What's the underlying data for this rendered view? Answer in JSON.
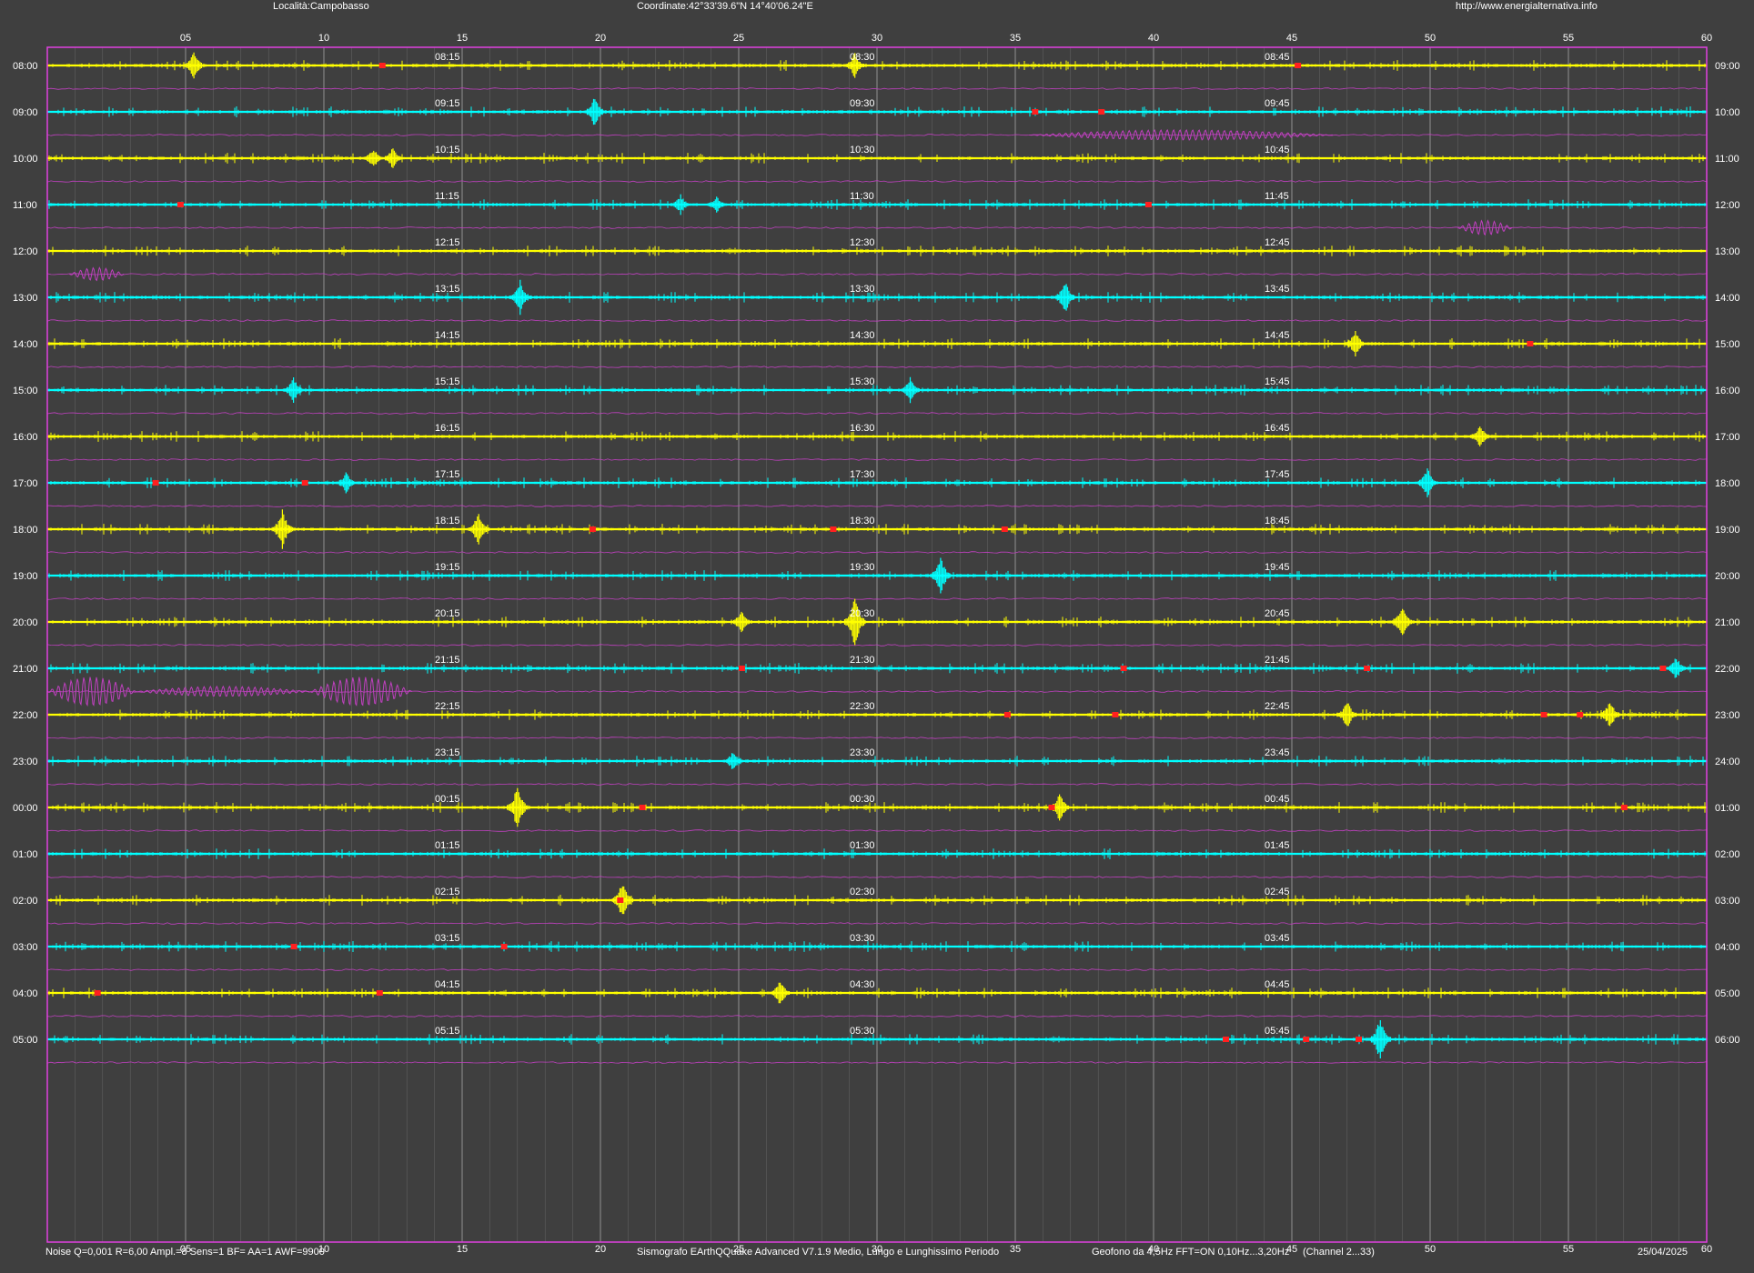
{
  "header": {
    "location": "Località:Campobasso",
    "coordinates": "Coordinate:42°33'39.6\"N  14°40'06.24\"E",
    "website": "http://www.energialternativa.info"
  },
  "footer": {
    "noise_params": "Noise Q=0,001 R=6,00 Ampl.=8 Sens=1 BF= AA=1 AWF=9900",
    "software": "Sismografo  EArthQQuake Advanced V7.1.9  Medio, Lungo e Lunghissimo Periodo",
    "sensor": "Geofono da 4,5Hz FFT=ON 0,10Hz...3,20Hz",
    "channels": "(Channel 2...33)",
    "date": "25/04/2025"
  },
  "colors": {
    "background": "#3f3f3f",
    "frame": "#e040e0",
    "trace_even": "#ffff00",
    "trace_odd": "#00ffff",
    "long_period": "#c040c0",
    "event_marker": "#ff2020",
    "grid": "#9a9a9a",
    "text": "#ffffff"
  },
  "chart_data": {
    "type": "helicorder",
    "x_axis": {
      "unit": "minutes",
      "range": [
        0,
        60
      ],
      "tick_labels": [
        "05",
        "10",
        "15",
        "20",
        "25",
        "30",
        "35",
        "40",
        "45",
        "50",
        "55",
        "60"
      ]
    },
    "grid": true,
    "rows": [
      {
        "left": "08:00",
        "right": "09:00",
        "q15": "08:15",
        "q30": "08:30",
        "q45": "08:45",
        "color": "yellow"
      },
      {
        "left": "09:00",
        "right": "10:00",
        "q15": "09:15",
        "q30": "09:30",
        "q45": "09:45",
        "color": "cyan"
      },
      {
        "left": "10:00",
        "right": "11:00",
        "q15": "10:15",
        "q30": "10:30",
        "q45": "10:45",
        "color": "yellow"
      },
      {
        "left": "11:00",
        "right": "12:00",
        "q15": "11:15",
        "q30": "11:30",
        "q45": "11:45",
        "color": "cyan"
      },
      {
        "left": "12:00",
        "right": "13:00",
        "q15": "12:15",
        "q30": "12:30",
        "q45": "12:45",
        "color": "yellow"
      },
      {
        "left": "13:00",
        "right": "14:00",
        "q15": "13:15",
        "q30": "13:30",
        "q45": "13:45",
        "color": "cyan"
      },
      {
        "left": "14:00",
        "right": "15:00",
        "q15": "14:15",
        "q30": "14:30",
        "q45": "14:45",
        "color": "yellow"
      },
      {
        "left": "15:00",
        "right": "16:00",
        "q15": "15:15",
        "q30": "15:30",
        "q45": "15:45",
        "color": "cyan"
      },
      {
        "left": "16:00",
        "right": "17:00",
        "q15": "16:15",
        "q30": "16:30",
        "q45": "16:45",
        "color": "yellow"
      },
      {
        "left": "17:00",
        "right": "18:00",
        "q15": "17:15",
        "q30": "17:30",
        "q45": "17:45",
        "color": "cyan"
      },
      {
        "left": "18:00",
        "right": "19:00",
        "q15": "18:15",
        "q30": "18:30",
        "q45": "18:45",
        "color": "yellow"
      },
      {
        "left": "19:00",
        "right": "20:00",
        "q15": "19:15",
        "q30": "19:30",
        "q45": "19:45",
        "color": "cyan"
      },
      {
        "left": "20:00",
        "right": "21:00",
        "q15": "20:15",
        "q30": "20:30",
        "q45": "20:45",
        "color": "yellow"
      },
      {
        "left": "21:00",
        "right": "22:00",
        "q15": "21:15",
        "q30": "21:30",
        "q45": "21:45",
        "color": "cyan"
      },
      {
        "left": "22:00",
        "right": "23:00",
        "q15": "22:15",
        "q30": "22:30",
        "q45": "22:45",
        "color": "yellow"
      },
      {
        "left": "23:00",
        "right": "24:00",
        "q15": "23:15",
        "q30": "23:30",
        "q45": "23:45",
        "color": "cyan"
      },
      {
        "left": "00:00",
        "right": "01:00",
        "q15": "00:15",
        "q30": "00:30",
        "q45": "00:45",
        "color": "yellow"
      },
      {
        "left": "01:00",
        "right": "02:00",
        "q15": "01:15",
        "q30": "01:30",
        "q45": "01:45",
        "color": "cyan"
      },
      {
        "left": "02:00",
        "right": "03:00",
        "q15": "02:15",
        "q30": "02:30",
        "q45": "02:45",
        "color": "yellow"
      },
      {
        "left": "03:00",
        "right": "04:00",
        "q15": "03:15",
        "q30": "03:30",
        "q45": "03:45",
        "color": "cyan"
      },
      {
        "left": "04:00",
        "right": "05:00",
        "q15": "04:15",
        "q30": "04:30",
        "q45": "04:45",
        "color": "yellow"
      },
      {
        "left": "05:00",
        "right": "06:00",
        "q15": "05:15",
        "q30": "05:30",
        "q45": "05:45",
        "color": "cyan"
      }
    ],
    "events": [
      {
        "row": 0,
        "minute": 12.1
      },
      {
        "row": 0,
        "minute": 45.2
      },
      {
        "row": 1,
        "minute": 35.7
      },
      {
        "row": 1,
        "minute": 38.1
      },
      {
        "row": 3,
        "minute": 4.8
      },
      {
        "row": 3,
        "minute": 39.8
      },
      {
        "row": 6,
        "minute": 53.6
      },
      {
        "row": 9,
        "minute": 3.9
      },
      {
        "row": 9,
        "minute": 9.3
      },
      {
        "row": 10,
        "minute": 19.7
      },
      {
        "row": 10,
        "minute": 28.4
      },
      {
        "row": 10,
        "minute": 34.6
      },
      {
        "row": 13,
        "minute": 25.1
      },
      {
        "row": 13,
        "minute": 38.9
      },
      {
        "row": 13,
        "minute": 47.7
      },
      {
        "row": 13,
        "minute": 58.4
      },
      {
        "row": 14,
        "minute": 34.7
      },
      {
        "row": 14,
        "minute": 38.6
      },
      {
        "row": 14,
        "minute": 54.1
      },
      {
        "row": 14,
        "minute": 55.4
      },
      {
        "row": 16,
        "minute": 21.5
      },
      {
        "row": 16,
        "minute": 36.3
      },
      {
        "row": 16,
        "minute": 57.0
      },
      {
        "row": 18,
        "minute": 20.7
      },
      {
        "row": 19,
        "minute": 8.9
      },
      {
        "row": 19,
        "minute": 16.5
      },
      {
        "row": 20,
        "minute": 1.8
      },
      {
        "row": 20,
        "minute": 12.0
      },
      {
        "row": 21,
        "minute": 42.6
      },
      {
        "row": 21,
        "minute": 45.5
      },
      {
        "row": 21,
        "minute": 47.4
      }
    ],
    "bursts": [
      {
        "row": 0,
        "minute": 5.3,
        "amp": 1.4
      },
      {
        "row": 0,
        "minute": 29.2,
        "amp": 1.3
      },
      {
        "row": 1,
        "minute": 19.8,
        "amp": 1.6
      },
      {
        "row": 2,
        "minute": 11.8,
        "amp": 1.1
      },
      {
        "row": 2,
        "minute": 12.5,
        "amp": 1.1
      },
      {
        "row": 3,
        "minute": 22.9,
        "amp": 1.0
      },
      {
        "row": 3,
        "minute": 24.2,
        "amp": 0.9
      },
      {
        "row": 5,
        "minute": 17.1,
        "amp": 1.7
      },
      {
        "row": 5,
        "minute": 36.8,
        "amp": 1.8
      },
      {
        "row": 6,
        "minute": 47.3,
        "amp": 1.3
      },
      {
        "row": 7,
        "minute": 8.9,
        "amp": 1.4
      },
      {
        "row": 7,
        "minute": 31.2,
        "amp": 1.2
      },
      {
        "row": 8,
        "minute": 51.8,
        "amp": 1.2
      },
      {
        "row": 9,
        "minute": 10.8,
        "amp": 1.1
      },
      {
        "row": 9,
        "minute": 49.9,
        "amp": 1.5
      },
      {
        "row": 10,
        "minute": 8.5,
        "amp": 2.0
      },
      {
        "row": 10,
        "minute": 15.6,
        "amp": 1.8
      },
      {
        "row": 11,
        "minute": 32.3,
        "amp": 1.9
      },
      {
        "row": 12,
        "minute": 29.2,
        "amp": 2.6
      },
      {
        "row": 12,
        "minute": 49.0,
        "amp": 1.8
      },
      {
        "row": 12,
        "minute": 25.1,
        "amp": 1.2
      },
      {
        "row": 13,
        "minute": 58.9,
        "amp": 1.2
      },
      {
        "row": 14,
        "minute": 56.5,
        "amp": 1.6
      },
      {
        "row": 14,
        "minute": 47.0,
        "amp": 1.4
      },
      {
        "row": 15,
        "minute": 24.8,
        "amp": 1.0
      },
      {
        "row": 16,
        "minute": 17.0,
        "amp": 2.3
      },
      {
        "row": 16,
        "minute": 36.6,
        "amp": 1.5
      },
      {
        "row": 18,
        "minute": 20.8,
        "amp": 2.0
      },
      {
        "row": 20,
        "minute": 26.5,
        "amp": 1.3
      },
      {
        "row": 21,
        "minute": 48.2,
        "amp": 2.4
      }
    ],
    "long_period_waves": [
      {
        "gap": 13,
        "start": 0,
        "end": 3.2,
        "amp": 1.0
      },
      {
        "gap": 13,
        "start": 9.5,
        "end": 13.2,
        "amp": 1.0
      },
      {
        "gap": 13,
        "start": 3.2,
        "end": 9.5,
        "amp": 0.35
      },
      {
        "gap": 1,
        "start": 35.5,
        "end": 46.5,
        "amp": 0.35
      },
      {
        "gap": 4,
        "start": 0.8,
        "end": 2.8,
        "amp": 0.45
      },
      {
        "gap": 3,
        "start": 51.0,
        "end": 53.0,
        "amp": 0.5
      }
    ]
  }
}
